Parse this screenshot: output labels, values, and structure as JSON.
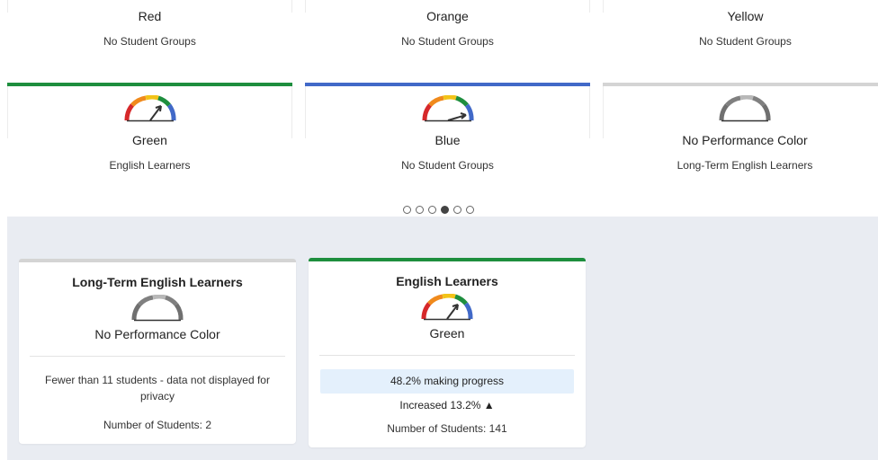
{
  "top_row": [
    {
      "color": "Red",
      "groups": "No Student Groups"
    },
    {
      "color": "Orange",
      "groups": "No Student Groups"
    },
    {
      "color": "Yellow",
      "groups": "No Student Groups"
    }
  ],
  "middle_row": [
    {
      "color": "Green",
      "groups": "English Learners",
      "accent": "#1e8e3e"
    },
    {
      "color": "Blue",
      "groups": "No Student Groups",
      "accent": "#4169c8"
    },
    {
      "color": "No Performance Color",
      "groups": "Long-Term English Learners",
      "accent": "#d4d4d4"
    }
  ],
  "carousel": {
    "pages": 6,
    "active_index": 3
  },
  "details": [
    {
      "title": "Long-Term English Learners",
      "color": "No Performance Color",
      "accent": "#d4d4d4",
      "note": "Fewer than 11 students - data not displayed for privacy",
      "students": "Number of Students: 2"
    },
    {
      "title": "English Learners",
      "color": "Green",
      "accent": "#1e8e3e",
      "progress": "48.2% making progress",
      "change": "Increased 13.2% ▲",
      "students": "Number of Students: 141"
    }
  ],
  "gauge_colors": {
    "red": "#d6282a",
    "orange": "#f08a1c",
    "yellow": "#f2c318",
    "green": "#1e8e3e",
    "blue": "#4169c8",
    "gray_dark": "#707070",
    "gray_light": "#b8b8b8"
  }
}
